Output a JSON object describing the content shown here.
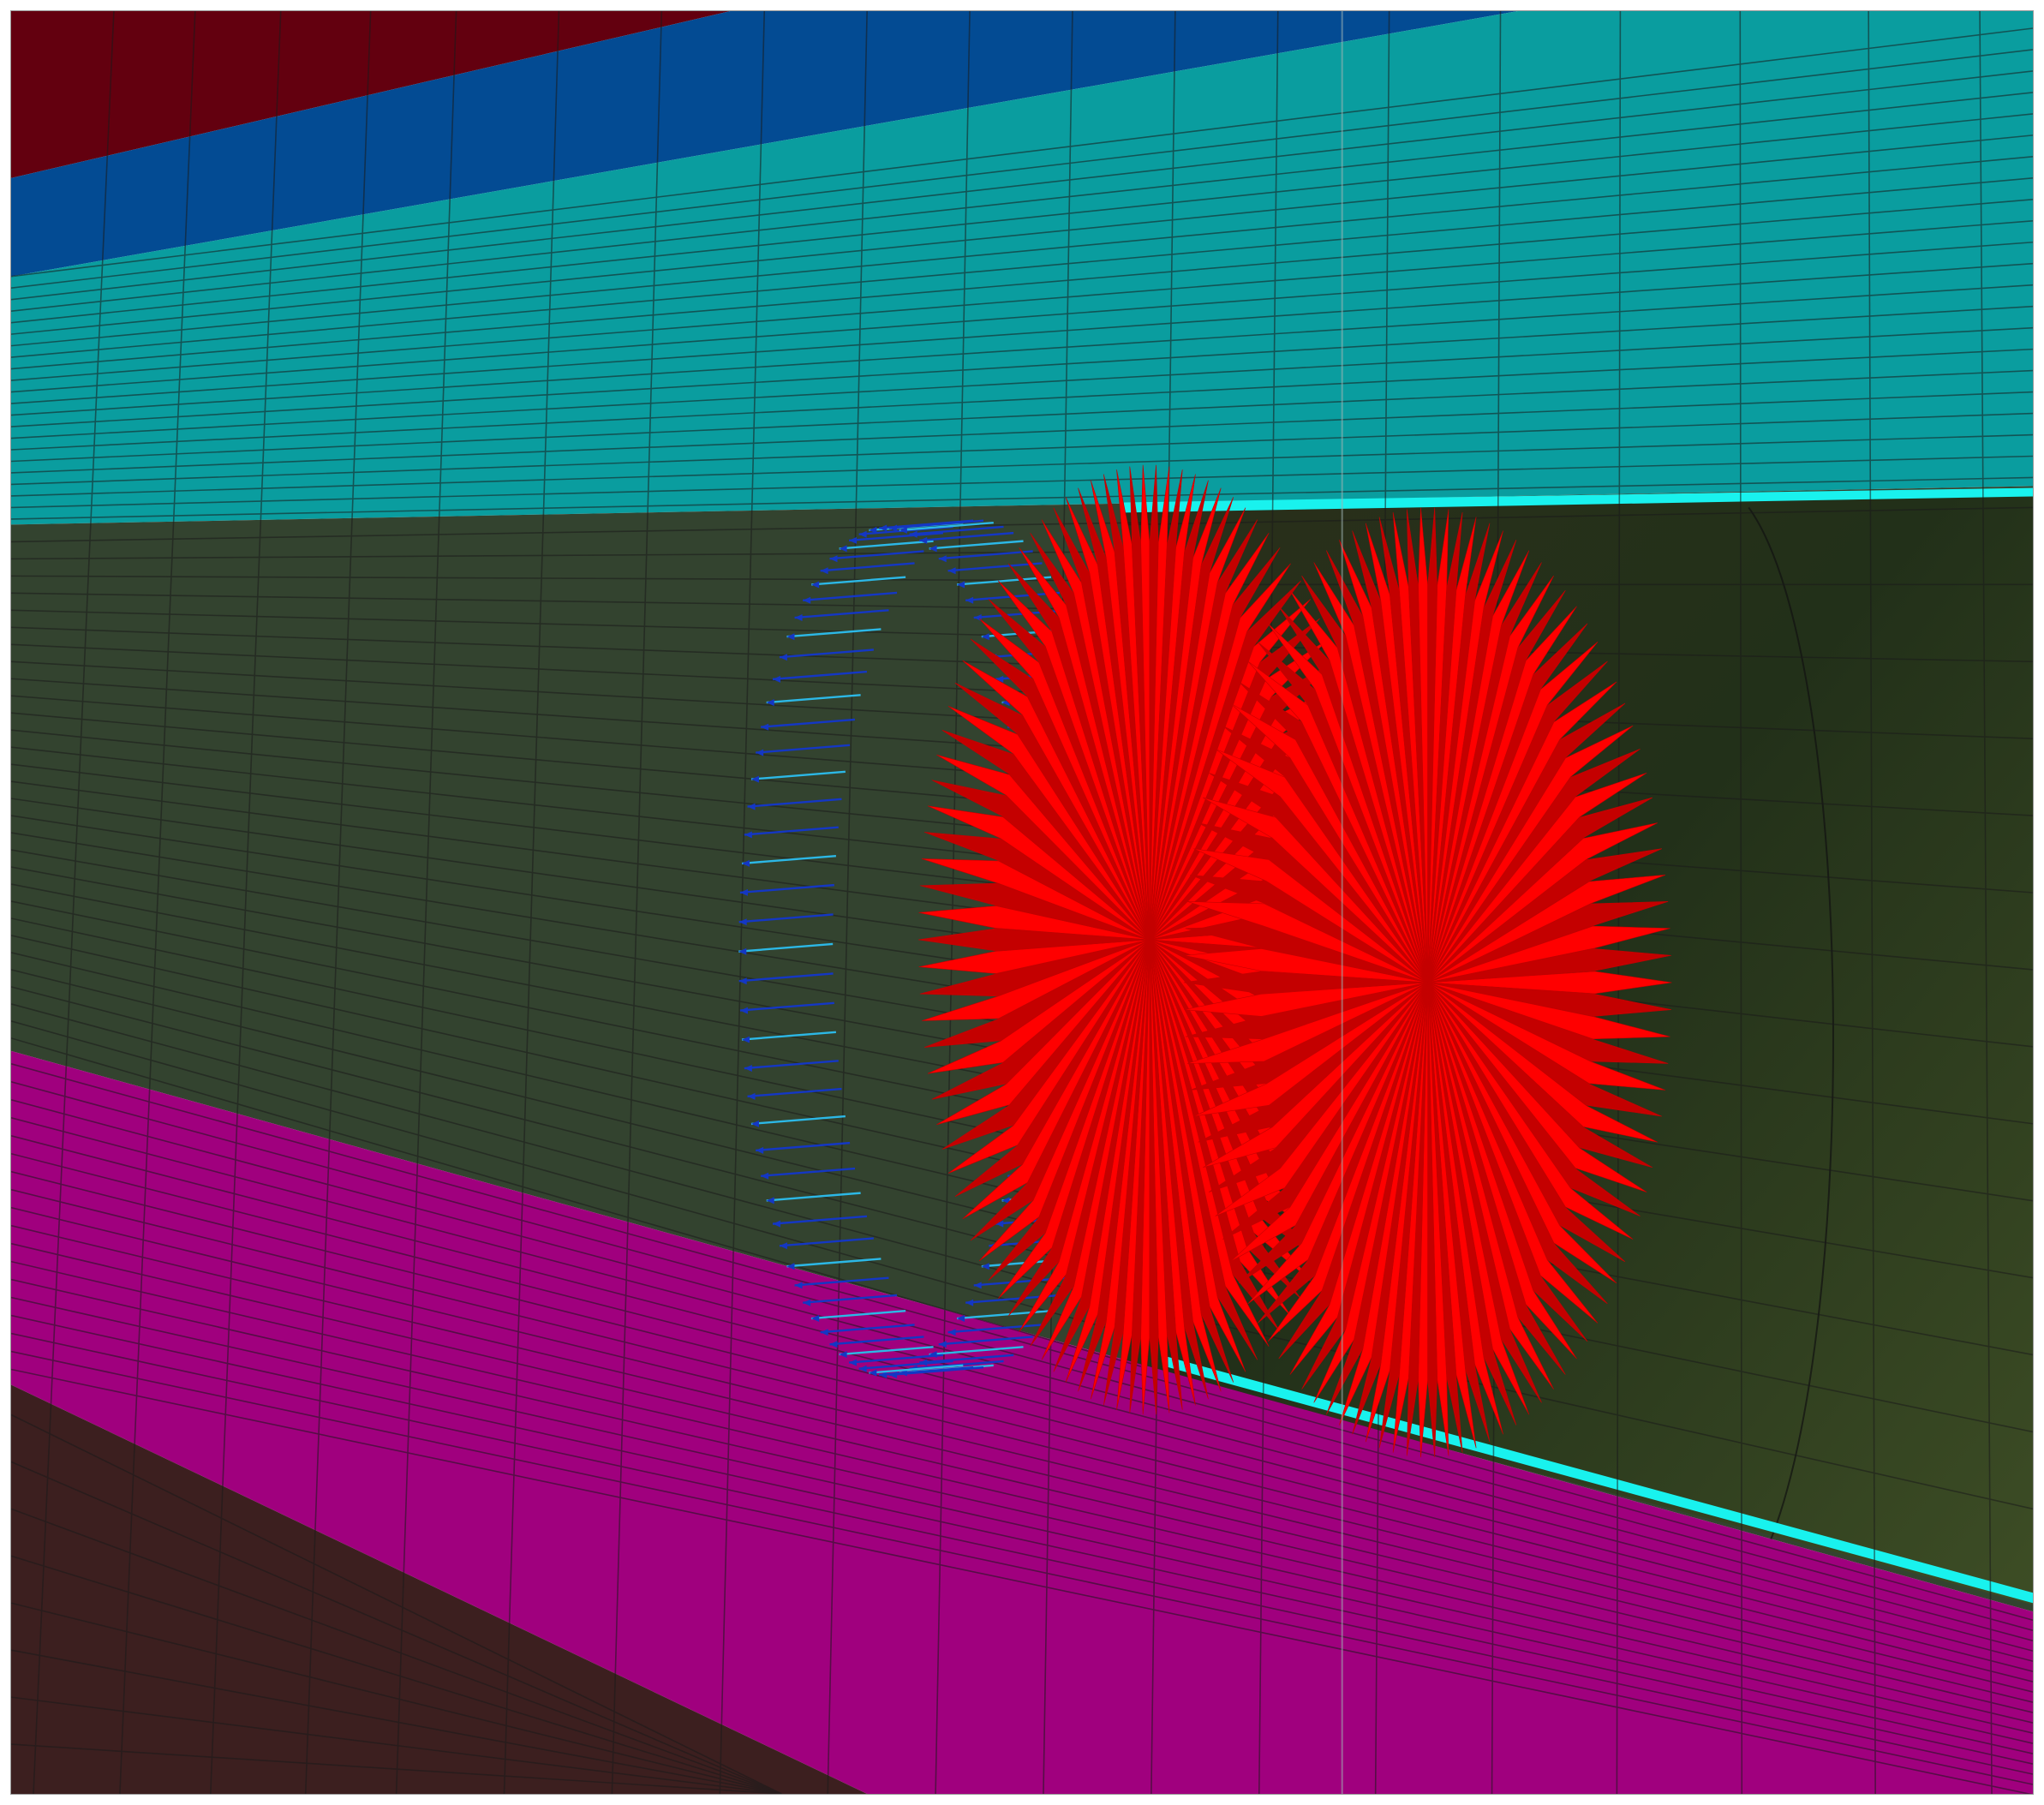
{
  "figure": {
    "kind": "finite-element mesh view",
    "description_visible_text": ""
  },
  "colors": {
    "frame": "#9a9a9a",
    "purple_corner": "#6a1fb0",
    "dark_red_band": "#63000f",
    "blue_band": "#034b93",
    "teal_layer": "#0a9d9f",
    "olive_tunnel": "#33432f",
    "tunnel_interior": "#223019",
    "tunnel_interior_light": "#3d4d25",
    "cyan_edge": "#19f2ee",
    "magenta_layer": "#a0007e",
    "bottom_brown": "#3c1f1f",
    "mesh_line": "#1a1a1a",
    "red_arrows": "#ff0000",
    "red_arrows_dark": "#c40000",
    "blue_arrows": "#1437c4",
    "cyan_arrows": "#2cb8e6"
  },
  "layers": [
    {
      "name": "dark-red-band",
      "color_key": "dark_red_band"
    },
    {
      "name": "blue-band",
      "color_key": "blue_band"
    },
    {
      "name": "teal-layer",
      "color_key": "teal_layer"
    },
    {
      "name": "tunnel-lining",
      "color_key": "olive_tunnel"
    },
    {
      "name": "magenta-layer",
      "color_key": "magenta_layer"
    },
    {
      "name": "bottom-layer",
      "color_key": "bottom_brown"
    }
  ],
  "arrow_rings": [
    {
      "name": "blue-arrow-ring",
      "color_key": "blue_arrows",
      "direction": "inward-left",
      "count": 90
    },
    {
      "name": "red-arrow-ring-front",
      "color_key": "red_arrows",
      "direction": "radial",
      "count": 110
    },
    {
      "name": "red-arrow-ring-back",
      "color_key": "red_arrows",
      "direction": "radial",
      "count": 110
    }
  ]
}
